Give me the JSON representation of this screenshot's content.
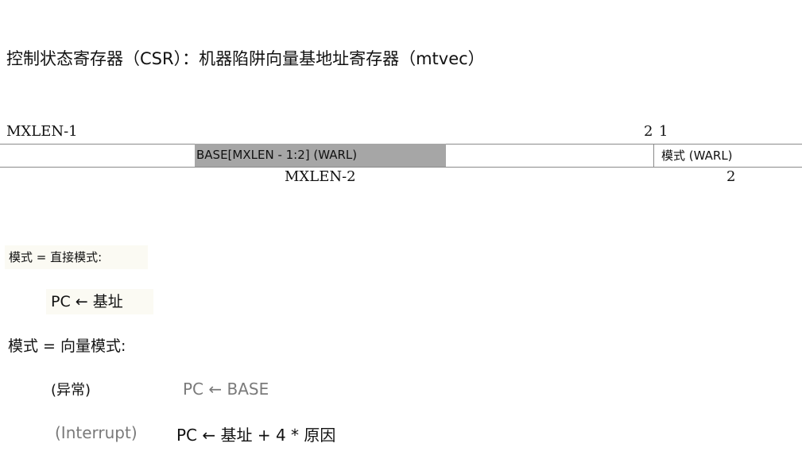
{
  "title": "控制状态寄存器（CSR）：机器陷阱向量基地址寄存器（mtvec）",
  "register": {
    "bit_high": "MXLEN-1",
    "bit_2": "2",
    "bit_1": "1",
    "base_field": "BASE[MXLEN - 1:2] (WARL)",
    "mode_field": "模式 (WARL)",
    "base_width": "MXLEN-2",
    "mode_width": "2"
  },
  "direct": {
    "heading": "模式 = 直接模式:",
    "formula": "PC ← 基址"
  },
  "vectored": {
    "heading": "模式 = 向量模式:",
    "exception_label": "(异常)",
    "exception_formula": "PC ← BASE",
    "interrupt_label": "(Interrupt)",
    "interrupt_formula": "PC ← 基址 + 4 * 原因"
  }
}
